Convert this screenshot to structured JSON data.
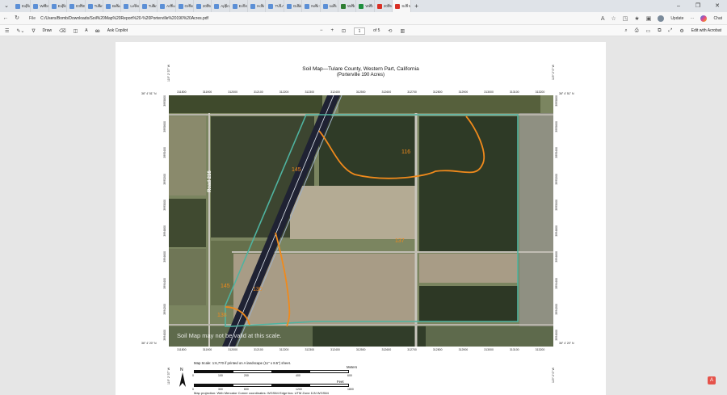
{
  "browser": {
    "tabs": [
      {
        "label": "Explo",
        "kind": "doc"
      },
      {
        "label": "Webs",
        "kind": "doc"
      },
      {
        "label": "Explo",
        "kind": "doc"
      },
      {
        "label": "ESSEN",
        "kind": "doc"
      },
      {
        "label": "Tulare",
        "kind": "doc"
      },
      {
        "label": "Beaut",
        "kind": "doc"
      },
      {
        "label": "Leveri",
        "kind": "doc"
      },
      {
        "label": "Tulare",
        "kind": "doc"
      },
      {
        "label": "Arthur",
        "kind": "doc"
      },
      {
        "label": "Great",
        "kind": "doc"
      },
      {
        "label": "2025 F",
        "kind": "doc"
      },
      {
        "label": "Appra",
        "kind": "doc"
      },
      {
        "label": "Ecomi",
        "kind": "doc"
      },
      {
        "label": "How t",
        "kind": "doc"
      },
      {
        "label": "TULA",
        "kind": "doc"
      },
      {
        "label": "Guide",
        "kind": "doc"
      },
      {
        "label": "New t",
        "kind": "doc"
      },
      {
        "label": "soils n",
        "kind": "doc"
      },
      {
        "label": "Web S",
        "kind": "web"
      },
      {
        "label": "Web S",
        "kind": "sheet"
      },
      {
        "label": "2025 I",
        "kind": "pdf"
      },
      {
        "label": "Soil M",
        "kind": "pdf",
        "active": true
      }
    ],
    "window_controls": [
      "–",
      "❐",
      "✕"
    ],
    "url_scheme": "File",
    "url": "C:/Users/Bomb/Downloads/Soil%20Map%20Report%20-%20Porterville%20190%20Acres.pdf",
    "update_label": "Update",
    "more_label": "···",
    "chat_label": "Chat"
  },
  "pdf_toolbar": {
    "draw_label": "Draw",
    "read_aloud_label": "A",
    "ask_copilot_label": "Ask Copilot",
    "zoom_out": "−",
    "zoom_in": "+",
    "page_current": "1",
    "page_total": "of 5",
    "edit_with_acrobat": "Edit with Acrobat"
  },
  "document": {
    "title": "Soil Map—Tulare County, Western Part, California",
    "subtitle": "(Porterville 190 Acres)",
    "map": {
      "top_ticks": [
        "311800",
        "311900",
        "312000",
        "312100",
        "312200",
        "312300",
        "312400",
        "312500",
        "312600",
        "312700",
        "312800",
        "312900",
        "313000",
        "313100",
        "313200"
      ],
      "bottom_ticks": [
        "311800",
        "311900",
        "312000",
        "312100",
        "312200",
        "312300",
        "312400",
        "312500",
        "312600",
        "312700",
        "312800",
        "312900",
        "313000",
        "313100",
        "313200"
      ],
      "left_ticks": [
        "3994000",
        "3994200",
        "3994400",
        "3994600",
        "3994800",
        "3995000",
        "3995200",
        "3995400",
        "3995600",
        "3995800"
      ],
      "corner_top_left": "36° 4' 51\" N",
      "corner_top_right": "36° 4' 51\" N",
      "corner_bottom_left": "36° 4' 20\" N",
      "corner_bottom_right": "36° 4' 20\" N",
      "corner_top_left_v": "119° 2' 37\" W",
      "corner_top_right_v": "119° 2' 0\" W",
      "corner_bottom_left_v": "119° 2' 37\" W",
      "corner_bottom_right_v": "119° 2' 0\" W",
      "road_label": "Road 216",
      "warning_text": "Soil Map may not be valid at this scale.",
      "unit_labels": [
        "116",
        "145",
        "137",
        "145",
        "130",
        "138"
      ]
    },
    "scale": {
      "map_scale_text": "Map Scale: 1:6,770 if printed on A landscape (11\" x 8.5\") sheet.",
      "meters_label": "Meters",
      "meters_ticks": [
        "0",
        "100",
        "200",
        "400",
        "600"
      ],
      "feet_label": "Feet",
      "feet_ticks": [
        "0",
        "300",
        "600",
        "1200",
        "1800"
      ],
      "north_label": "N",
      "projection_text": "Map projection: Web Mercator   Corner coordinates: WGS84   Edge tics: UTM Zone 11N WGS84"
    }
  },
  "colors": {
    "soil_boundary": "#f08a1c",
    "aoi_outline": "#4fb3a0",
    "acrobat_red": "#e5534b"
  }
}
